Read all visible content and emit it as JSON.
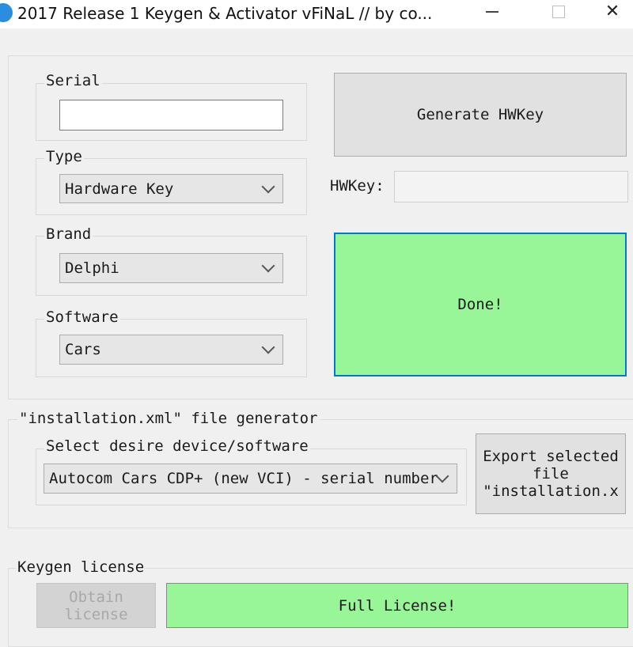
{
  "window": {
    "title": "2017 Release 1 Keygen & Activator vFiNaL // by co...",
    "minimize_glyph": "",
    "close_glyph": "✕"
  },
  "serial": {
    "label": "Serial",
    "value": ""
  },
  "type": {
    "label": "Type",
    "selected": "Hardware Key"
  },
  "brand": {
    "label": "Brand",
    "selected": "Delphi"
  },
  "software": {
    "label": "Software",
    "selected": "Cars"
  },
  "hwkey": {
    "generate_label": "Generate HWKey",
    "field_label": "HWKey:",
    "value": ""
  },
  "status": {
    "text": "Done!",
    "color": "#98f598",
    "border_color": "#0078d7"
  },
  "installation": {
    "group_label": "\"installation.xml\" file generator",
    "select_label": "Select desire device/software",
    "selected": "Autocom Cars CDP+ (new VCI) - serial number",
    "export_label": "Export selected file \"installation.x"
  },
  "license": {
    "group_label": "Keygen license",
    "obtain_label": "Obtain license",
    "full_label": "Full License!",
    "full_color": "#98f598"
  }
}
